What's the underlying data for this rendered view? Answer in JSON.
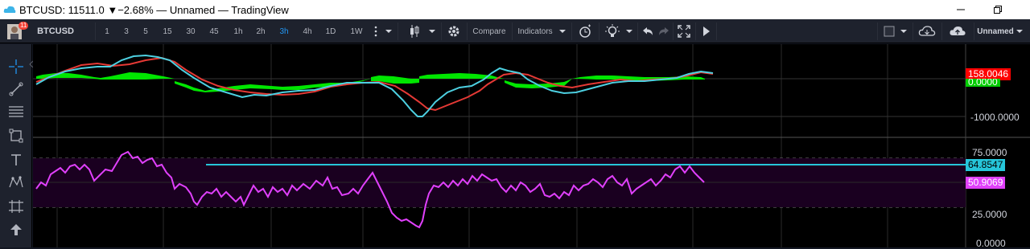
{
  "window": {
    "title": "BTCUSD: 11511.0 ▼−2.68% — Unnamed — TradingView",
    "minimize_icon": "minimize-icon",
    "restore_icon": "restore-icon"
  },
  "toolbar": {
    "avatar_badge": "11",
    "symbol": "BTCUSD",
    "intervals": [
      "1",
      "3",
      "5",
      "15",
      "30",
      "45",
      "1h",
      "2h",
      "3h",
      "4h",
      "1D",
      "1W"
    ],
    "active_interval": "3h",
    "compare_label": "Compare",
    "indicators_label": "Indicators",
    "layout_name": "Unnamed"
  },
  "left_tools": [
    "crosshair-icon",
    "trendline-icon",
    "fib-icon",
    "rectangle-icon",
    "text-icon",
    "pattern-icon",
    "prediction-icon",
    "scroll-up-icon"
  ],
  "chart": {
    "pane1_axis": [
      "-1000.0000"
    ],
    "pane1_tag_red": "158.0046",
    "pane1_tag_green_partial": "0.0000",
    "pane2_axis": [
      "75.0000",
      "25.0000",
      "0.0000"
    ],
    "pane2_tag_cyan": "64.8547",
    "pane2_tag_magenta": "50.9069",
    "colors": {
      "cyan": "#4dd0e1",
      "red": "#e53935",
      "green": "#00e600",
      "magenta": "#e040fb",
      "tag_red": "#ff0000",
      "tag_cyan": "#26c6da",
      "tag_magenta": "#e040fb"
    }
  }
}
